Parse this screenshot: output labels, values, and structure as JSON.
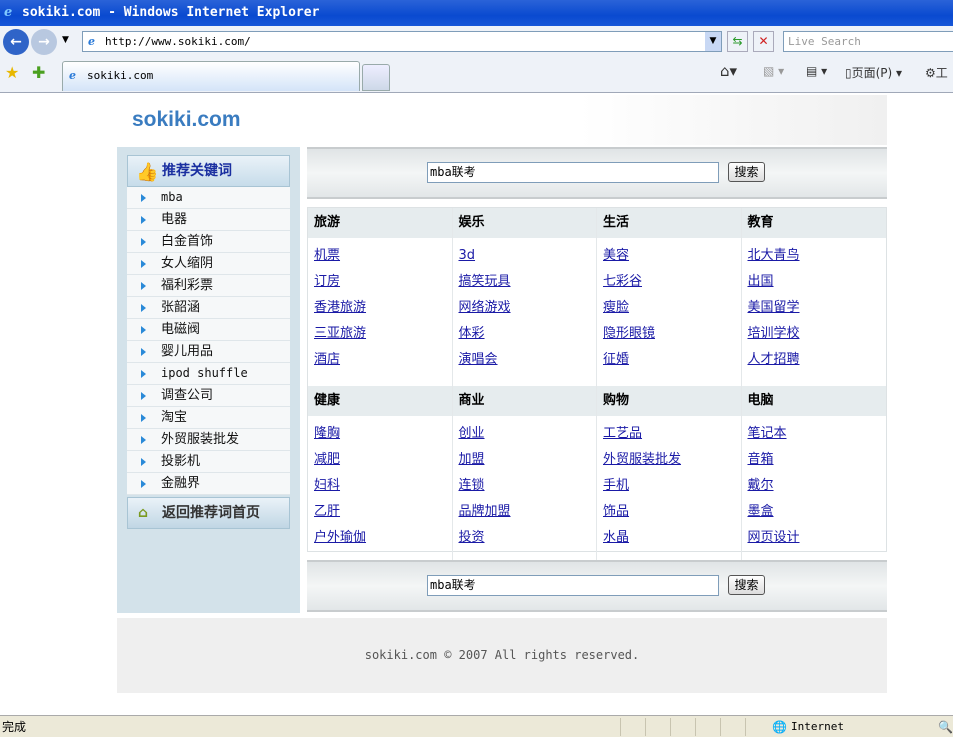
{
  "window": {
    "title": "sokiki.com - Windows Internet Explorer"
  },
  "browser": {
    "url": "http://www.sokiki.com/",
    "search_placeholder": "Live Search",
    "tab_label": "sokiki.com",
    "page_menu": "页面(P)",
    "tools_menu": "工"
  },
  "site": {
    "logo": "sokiki.com"
  },
  "sidebar": {
    "title": "推荐关键词",
    "items": [
      "mba",
      "电器",
      "白金首饰",
      "女人缩阴",
      "福利彩票",
      "张韶涵",
      "电磁阀",
      "婴儿用品",
      "ipod shuffle",
      "调查公司",
      "淘宝",
      "外贸服装批发",
      "投影机",
      "金融界"
    ],
    "back_label": "返回推荐词首页"
  },
  "search": {
    "value": "mba联考",
    "button": "搜索"
  },
  "sections": [
    [
      {
        "title": "旅游",
        "links": [
          "机票",
          "订房",
          "香港旅游",
          "三亚旅游",
          "酒店"
        ]
      },
      {
        "title": "娱乐",
        "links": [
          "3d",
          "搞笑玩具",
          "网络游戏",
          "体彩",
          "演唱会"
        ]
      },
      {
        "title": "生活",
        "links": [
          "美容",
          "七彩谷",
          "瘦脸",
          "隐形眼镜",
          "征婚"
        ]
      },
      {
        "title": "教育",
        "links": [
          "北大青鸟",
          "出国",
          "美国留学",
          "培训学校",
          "人才招聘"
        ]
      }
    ],
    [
      {
        "title": "健康",
        "links": [
          "隆胸",
          "减肥",
          "妇科",
          "乙肝",
          "户外瑜伽"
        ]
      },
      {
        "title": "商业",
        "links": [
          "创业",
          "加盟",
          "连锁",
          "品牌加盟",
          "投资"
        ]
      },
      {
        "title": "购物",
        "links": [
          "工艺品",
          "外贸服装批发",
          "手机",
          "饰品",
          "水晶"
        ]
      },
      {
        "title": "电脑",
        "links": [
          "笔记本",
          "音箱",
          "戴尔",
          "墨盒",
          "网页设计"
        ]
      }
    ]
  ],
  "footer": {
    "text": "sokiki.com © 2007 All rights reserved."
  },
  "status": {
    "left": "完成",
    "zone": "Internet"
  }
}
